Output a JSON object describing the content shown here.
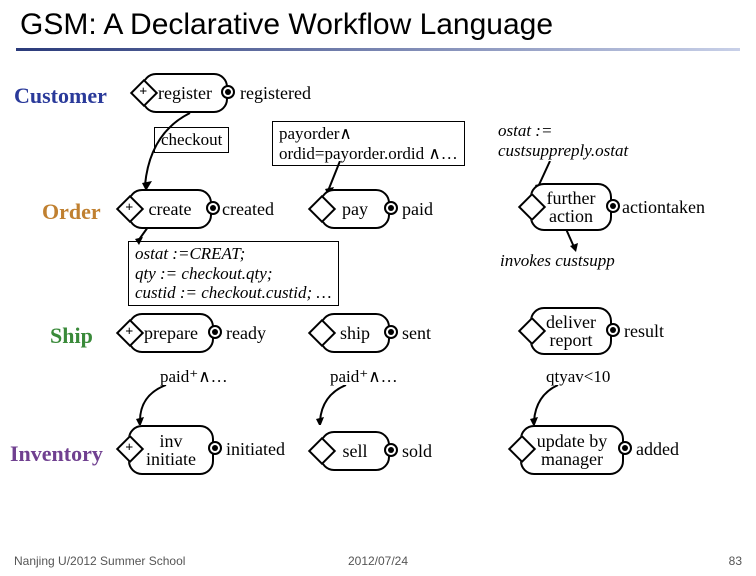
{
  "title": "GSM: A Declarative Workflow Language",
  "rows": {
    "customer": "Customer",
    "order": "Order",
    "ship": "Ship",
    "inventory": "Inventory"
  },
  "stages": {
    "register": "register",
    "create": "create",
    "pay": "pay",
    "further_action": "further\naction",
    "prepare": "prepare",
    "ship": "ship",
    "deliver_report": "deliver\nreport",
    "inv_initiate": "inv\ninitiate",
    "sell": "sell",
    "update_by_manager": "update by\nmanager"
  },
  "milestones": {
    "registered": "registered",
    "created": "created",
    "paid": "paid",
    "actiontaken": "actiontaken",
    "ready": "ready",
    "sent": "sent",
    "result": "result",
    "initiated": "initiated",
    "sold": "sold",
    "added": "added"
  },
  "annotations": {
    "checkout": "checkout",
    "payorder": "payorder∧\nordid=payorder.ordid ∧…",
    "ostat_assign": "ostat :=\ncustsuppreply.ostat",
    "ostat_creat": "ostat :=CREAT;\nqty := checkout.qty;\ncustid := checkout.custid; …",
    "invokes": "invokes custsupp",
    "paid_plus_left": "paid⁺∧…",
    "paid_plus_right": "paid⁺∧…",
    "qtyav": "qtyav<10"
  },
  "footer": {
    "left": "Nanjing U/2012 Summer School",
    "date": "2012/07/24",
    "page": "83"
  }
}
